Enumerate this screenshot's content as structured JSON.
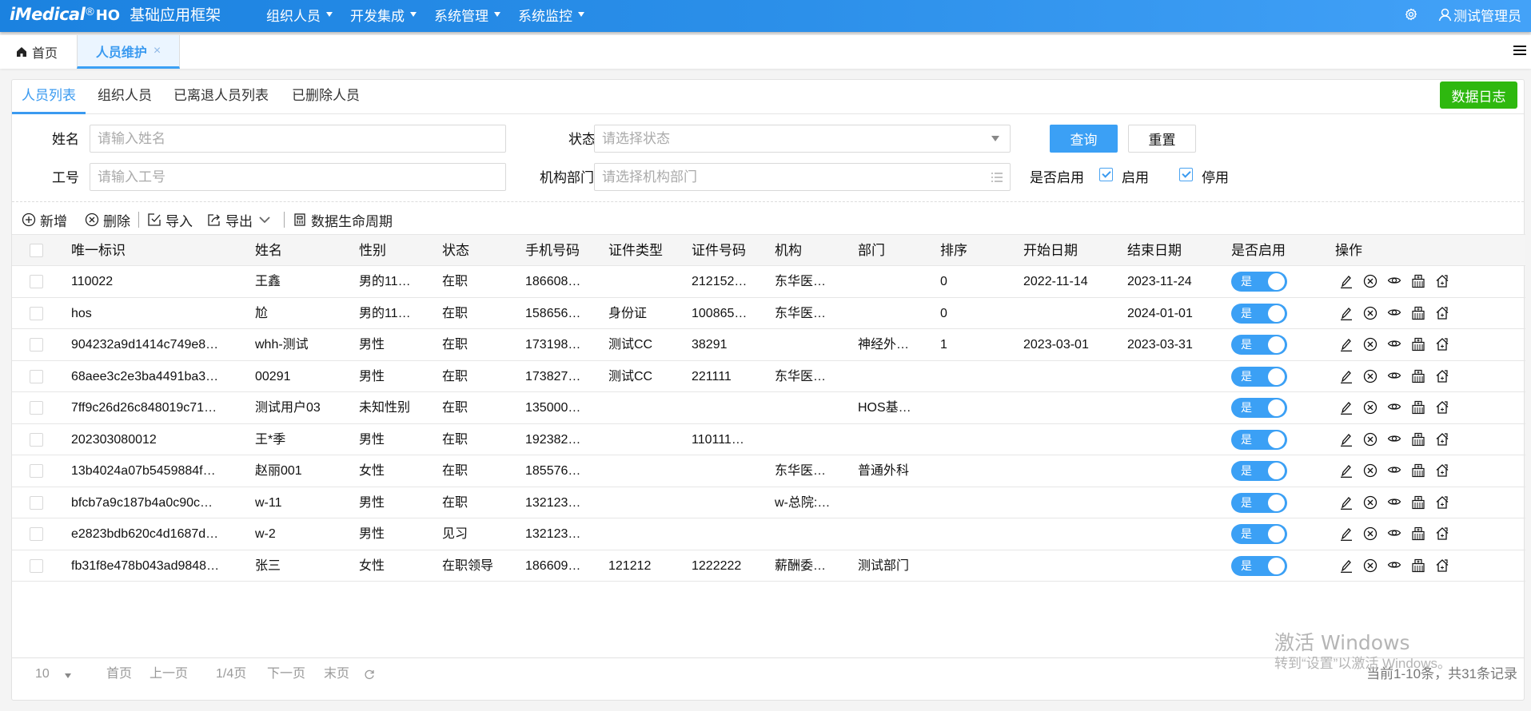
{
  "header": {
    "logo": "iMedical",
    "logo_reg": "®",
    "logo_suffix": "HO",
    "app_title": "基础应用框架",
    "nav": [
      {
        "label": "组织人员",
        "icon": "chevron-down-icon"
      },
      {
        "label": "开发集成",
        "icon": "chevron-down-icon"
      },
      {
        "label": "系统管理",
        "icon": "chevron-down-icon"
      },
      {
        "label": "系统监控",
        "icon": "chevron-down-icon"
      }
    ],
    "settings_icon": "gear-icon",
    "user_icon": "user-icon",
    "user_name": "测试管理员"
  },
  "tabstrip": {
    "home_label": "首页",
    "home_icon": "home-icon",
    "active_tab_label": "人员维护",
    "active_tab_close": "×",
    "menu_icon": "hamburger-menu-icon"
  },
  "subtabs": {
    "items": [
      {
        "label": "人员列表",
        "active": true
      },
      {
        "label": "组织人员",
        "active": false
      },
      {
        "label": "已离退人员列表",
        "active": false
      },
      {
        "label": "已删除人员",
        "active": false
      }
    ],
    "data_log_button": "数据日志"
  },
  "filters": {
    "name_label": "姓名",
    "name_placeholder": "请输入姓名",
    "name_value": "",
    "status_label": "状态",
    "status_placeholder": "请选择状态",
    "status_value": "",
    "code_label": "工号",
    "code_placeholder": "请输入工号",
    "code_value": "",
    "org_label": "机构部门",
    "org_placeholder": "请选择机构部门",
    "org_value": "",
    "query_button": "查询",
    "reset_button": "重置",
    "enabled_label": "是否启用",
    "enabled_options": [
      {
        "label": "启用",
        "checked": true
      },
      {
        "label": "停用",
        "checked": true
      }
    ]
  },
  "toolbar": {
    "add": "新增",
    "delete": "删除",
    "import": "导入",
    "export": "导出",
    "lifecycle": "数据生命周期"
  },
  "table": {
    "columns": [
      "唯一标识",
      "姓名",
      "性别",
      "状态",
      "手机号码",
      "证件类型",
      "证件号码",
      "机构",
      "部门",
      "排序",
      "开始日期",
      "结束日期",
      "是否启用",
      "操作"
    ],
    "toggle_on_label": "是",
    "row_actions": [
      "edit-icon",
      "cancel-icon",
      "view-icon",
      "hospital-icon",
      "home-plus-icon"
    ],
    "rows": [
      {
        "id": "110022",
        "name": "王鑫",
        "gender": "男的11…",
        "status": "在职",
        "phone": "186608…",
        "cert_type": "",
        "cert_no": "212152…",
        "org": "东华医…",
        "dept": "",
        "sort": "0",
        "start": "2022-11-14",
        "end": "2023-11-24",
        "enabled": true
      },
      {
        "id": "hos",
        "name": "尬",
        "gender": "男的11…",
        "status": "在职",
        "phone": "158656…",
        "cert_type": "身份证",
        "cert_no": "100865…",
        "org": "东华医…",
        "dept": "",
        "sort": "0",
        "start": "",
        "end": "2024-01-01",
        "enabled": true
      },
      {
        "id": "904232a9d1414c749e8…",
        "name": "whh-测试",
        "gender": "男性",
        "status": "在职",
        "phone": "173198…",
        "cert_type": "测试CC",
        "cert_no": "38291",
        "org": "",
        "dept": "神经外…",
        "sort": "1",
        "start": "2023-03-01",
        "end": "2023-03-31",
        "enabled": true
      },
      {
        "id": "68aee3c2e3ba4491ba3…",
        "name": "00291",
        "gender": "男性",
        "status": "在职",
        "phone": "173827…",
        "cert_type": "测试CC",
        "cert_no": "221111",
        "org": "东华医…",
        "dept": "",
        "sort": "",
        "start": "",
        "end": "",
        "enabled": true
      },
      {
        "id": "7ff9c26d26c848019c71…",
        "name": "测试用户03",
        "gender": "未知性别",
        "status": "在职",
        "phone": "135000…",
        "cert_type": "",
        "cert_no": "",
        "org": "",
        "dept": "HOS基…",
        "sort": "",
        "start": "",
        "end": "",
        "enabled": true
      },
      {
        "id": "202303080012",
        "name": "王*季",
        "gender": "男性",
        "status": "在职",
        "phone": "192382…",
        "cert_type": "",
        "cert_no": "110111…",
        "org": "",
        "dept": "",
        "sort": "",
        "start": "",
        "end": "",
        "enabled": true
      },
      {
        "id": "13b4024a07b5459884f…",
        "name": "赵丽001",
        "gender": "女性",
        "status": "在职",
        "phone": "185576…",
        "cert_type": "",
        "cert_no": "",
        "org": "东华医…",
        "dept": "普通外科",
        "sort": "",
        "start": "",
        "end": "",
        "enabled": true
      },
      {
        "id": "bfcb7a9c187b4a0c90c…",
        "name": "w-11",
        "gender": "男性",
        "status": "在职",
        "phone": "132123…",
        "cert_type": "",
        "cert_no": "",
        "org": "w-总院:…",
        "dept": "",
        "sort": "",
        "start": "",
        "end": "",
        "enabled": true
      },
      {
        "id": "e2823bdb620c4d1687d…",
        "name": "w-2",
        "gender": "男性",
        "status": "见习",
        "phone": "132123…",
        "cert_type": "",
        "cert_no": "",
        "org": "",
        "dept": "",
        "sort": "",
        "start": "",
        "end": "",
        "enabled": true
      },
      {
        "id": "fb31f8e478b043ad9848…",
        "name": "张三",
        "gender": "女性",
        "status": "在职领导",
        "phone": "186609…",
        "cert_type": "121212",
        "cert_no": "1222222",
        "org": "薪酬委…",
        "dept": "测试部门",
        "sort": "",
        "start": "",
        "end": "",
        "enabled": true
      }
    ]
  },
  "pager": {
    "page_size": "10",
    "first": "首页",
    "prev": "上一页",
    "current": "1/4页",
    "next": "下一页",
    "last": "末页",
    "summary": "当前1-10条，共31条记录"
  },
  "watermark": {
    "line1": "激活 Windows",
    "line2": "转到“设置”以激活 Windows。"
  },
  "colors": {
    "primary": "#3ba0f5",
    "header_start": "#1b82e0",
    "header_end": "#43a2f8",
    "success": "#2eb80f"
  }
}
